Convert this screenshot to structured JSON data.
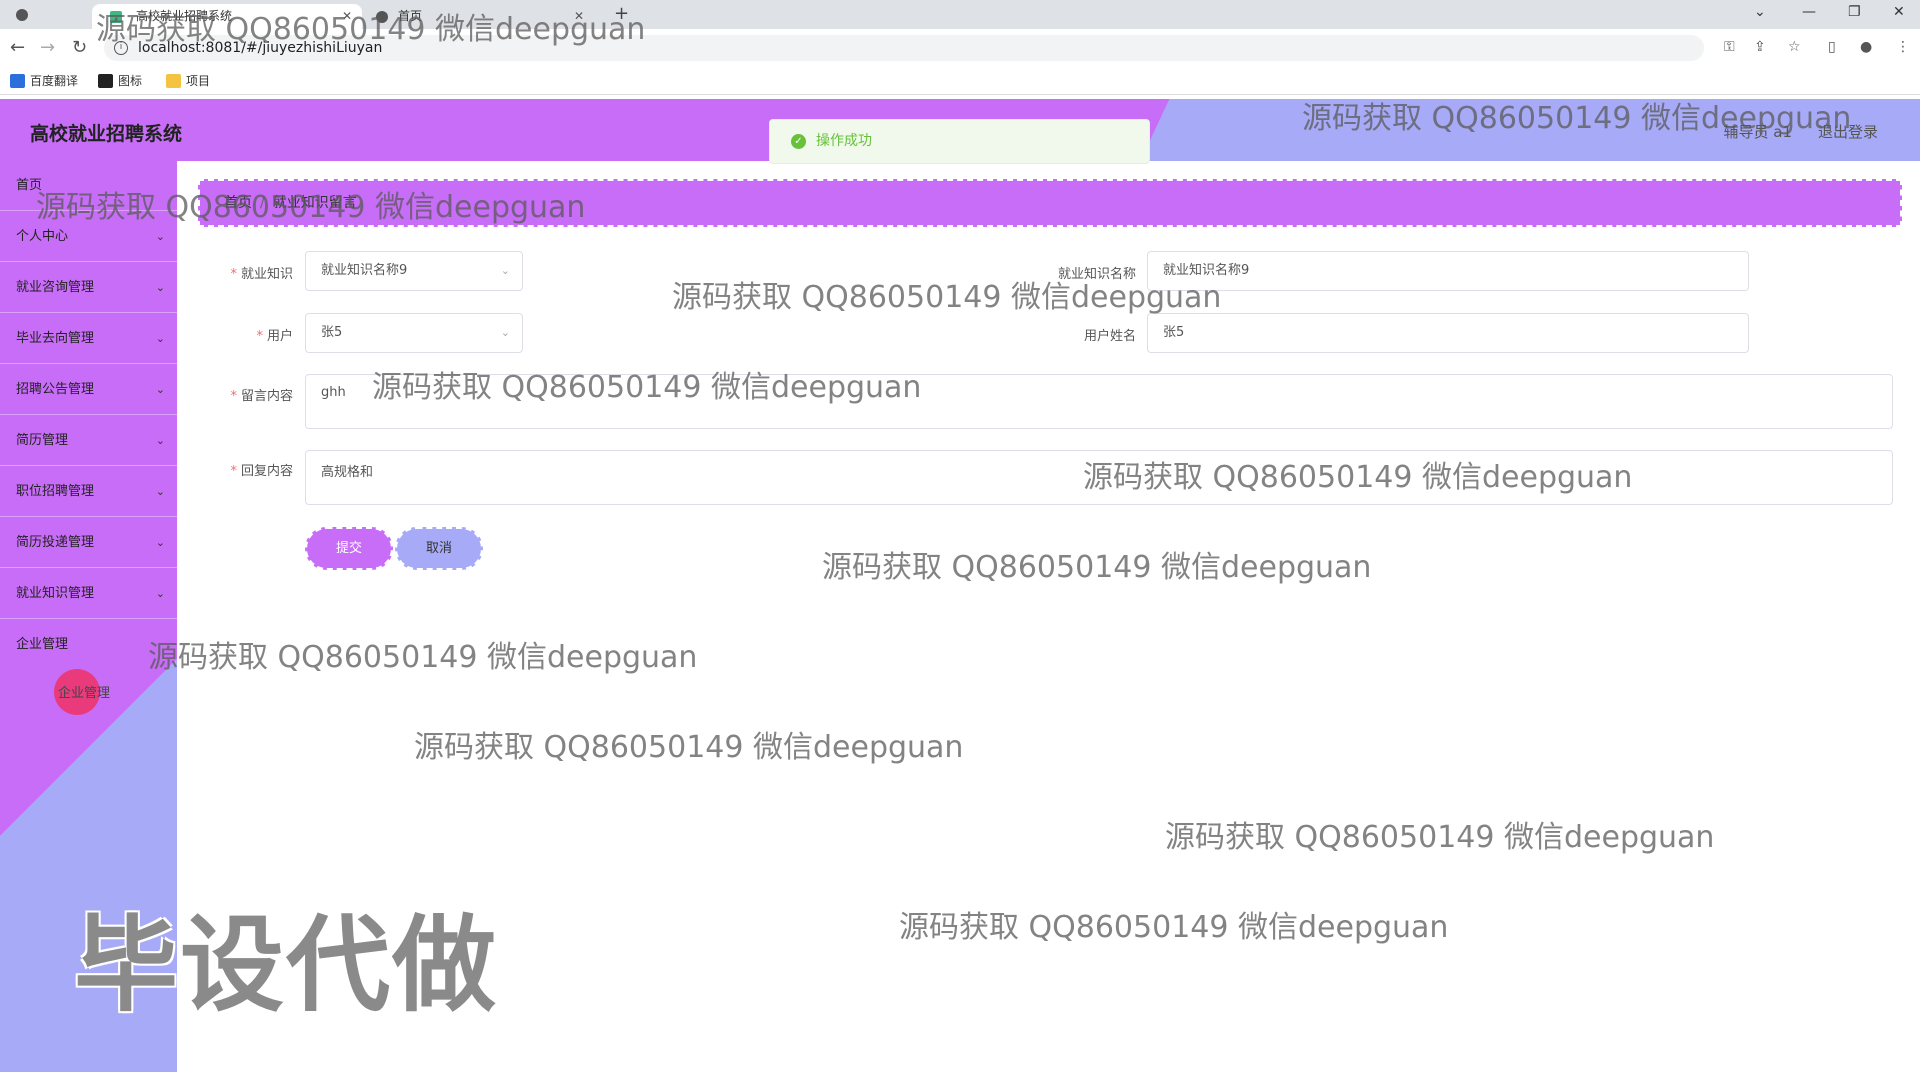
{
  "browser": {
    "tabs": [
      {
        "label": ""
      },
      {
        "label": ""
      },
      {
        "label": "高校就业招聘系统"
      },
      {
        "label": "首页"
      }
    ],
    "url": "localhost:8081/#/jiuyezhishiLiuyan",
    "bookmarks": [
      {
        "label": "百度翻译",
        "color": "#2a6fdb"
      },
      {
        "label": "图标",
        "color": "#222222"
      },
      {
        "label": "项目",
        "color": "#f5c342"
      }
    ]
  },
  "header": {
    "title": "高校就业招聘系统",
    "user": "辅导员 a1",
    "logout": "退出登录"
  },
  "toast": {
    "message": "操作成功"
  },
  "sidebar": {
    "items": [
      {
        "label": "首页",
        "has_children": false
      },
      {
        "label": "个人中心",
        "has_children": true
      },
      {
        "label": "就业咨询管理",
        "has_children": true
      },
      {
        "label": "毕业去向管理",
        "has_children": true
      },
      {
        "label": "招聘公告管理",
        "has_children": true
      },
      {
        "label": "简历管理",
        "has_children": true
      },
      {
        "label": "职位招聘管理",
        "has_children": true
      },
      {
        "label": "简历投递管理",
        "has_children": true
      },
      {
        "label": "就业知识管理",
        "has_children": true
      },
      {
        "label": "企业管理",
        "has_children": false
      }
    ],
    "sub_item": "企业管理"
  },
  "breadcrumb": {
    "home": "首页",
    "current": "就业知识留言"
  },
  "form": {
    "knowledge": {
      "label": "就业知识",
      "value": "就业知识名称9"
    },
    "knowledge_name": {
      "label": "就业知识名称",
      "value": "就业知识名称9"
    },
    "user": {
      "label": "用户",
      "value": "张5"
    },
    "user_name": {
      "label": "用户姓名",
      "value": "张5"
    },
    "message": {
      "label": "留言内容",
      "value": "ghh"
    },
    "reply": {
      "label": "回复内容",
      "value": "高规格和"
    },
    "submit": "提交",
    "cancel": "取消"
  },
  "watermarks": {
    "text": "源码获取 QQ86050149 微信deepguan",
    "big": "毕设代做"
  },
  "colors": {
    "primary": "#c86df7",
    "secondary": "#a7aaf7",
    "success": "#67c23a",
    "required": "#f56c6c"
  }
}
